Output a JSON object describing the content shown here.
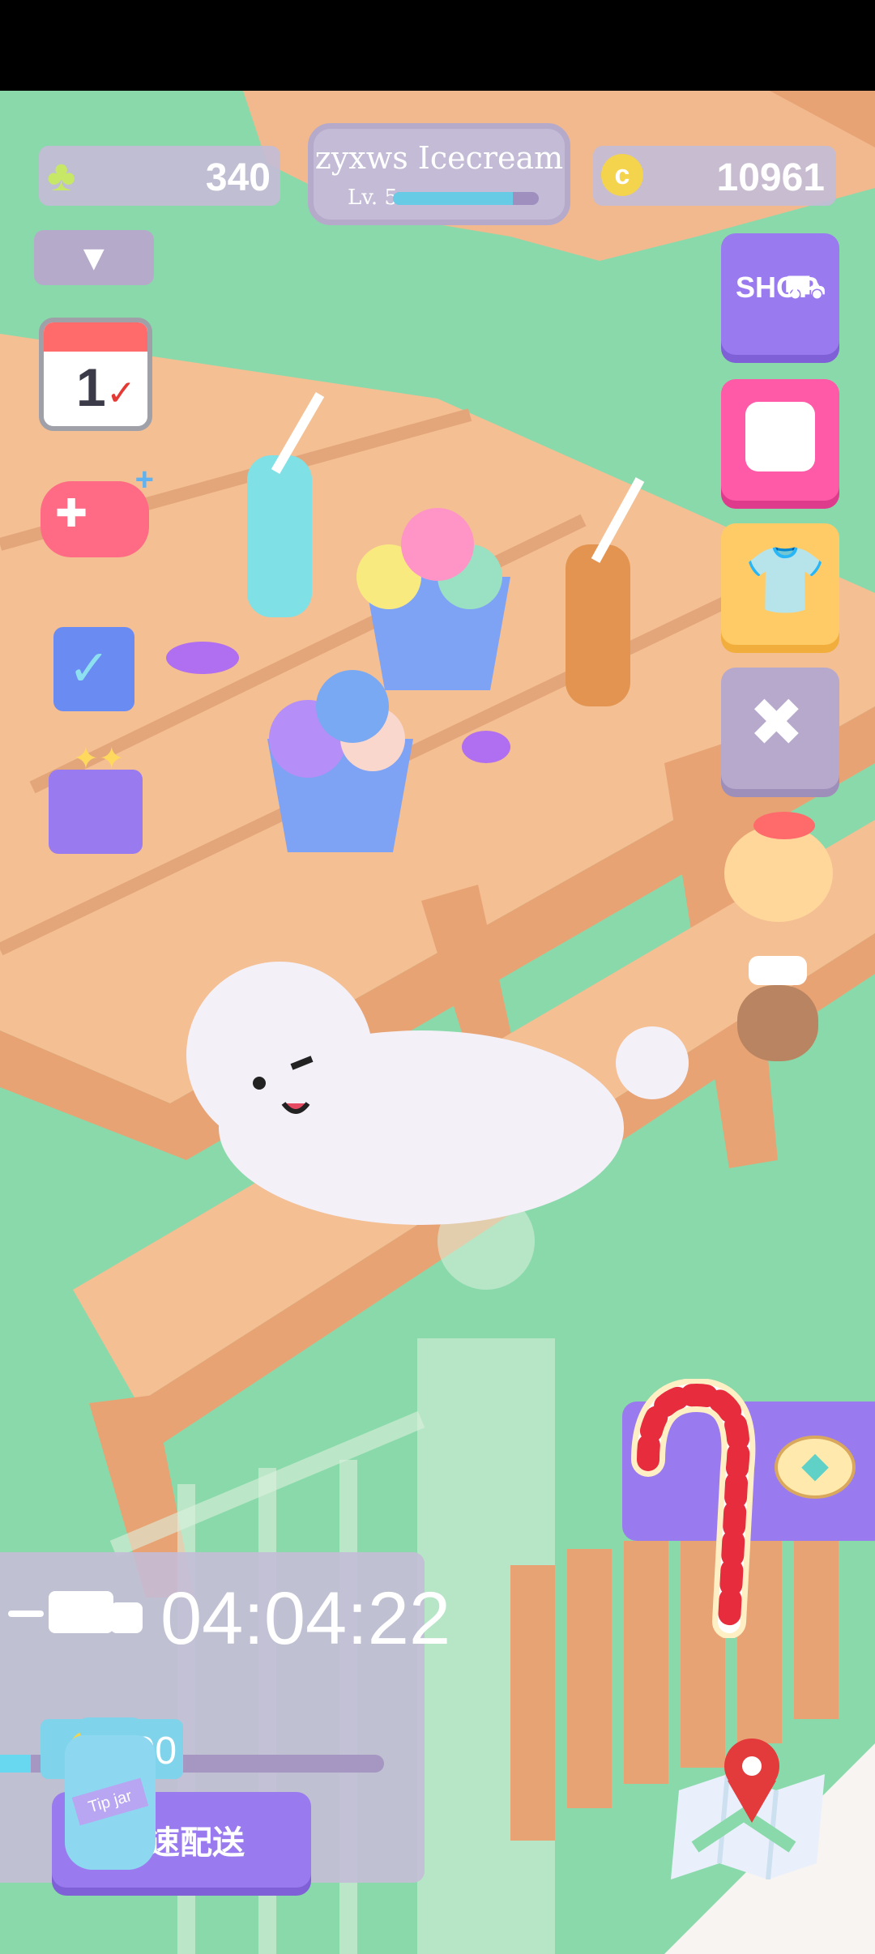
{
  "hud": {
    "clover_count": "340",
    "player_name": "zyxws Icecream",
    "level": "Lv. 5",
    "level_progress": 0.82,
    "coin_count": "10961"
  },
  "right_menu": {
    "shop_label": "SHOP"
  },
  "calendar": {
    "day": "1"
  },
  "delivery": {
    "timer": "04:04:22",
    "reward": "100",
    "button_label": "速配送",
    "progress": 0.08
  },
  "tip_jar": {
    "label": "Tip jar"
  },
  "colors": {
    "grass": "#8ad9ab",
    "purple_button": "#9a7bef",
    "pink_button": "#ff5aa7",
    "yellow_button": "#ffcb67",
    "gray_button": "#b7a9cc",
    "wood": "#f1b182"
  },
  "icons": [
    "clover-icon",
    "coin-icon",
    "dropdown-arrow-icon",
    "calendar-icon",
    "gamepad-plus-icon",
    "task-check-icon",
    "gift-box-icon",
    "shop-cart-icon",
    "treasure-chest-icon",
    "tshirt-icon",
    "tools-icon",
    "poodle-avatar-icon",
    "cat-chef-avatar-icon",
    "candy-cane-icon",
    "diamond-icon",
    "truck-icon",
    "tip-jar-icon",
    "map-pin-icon"
  ]
}
